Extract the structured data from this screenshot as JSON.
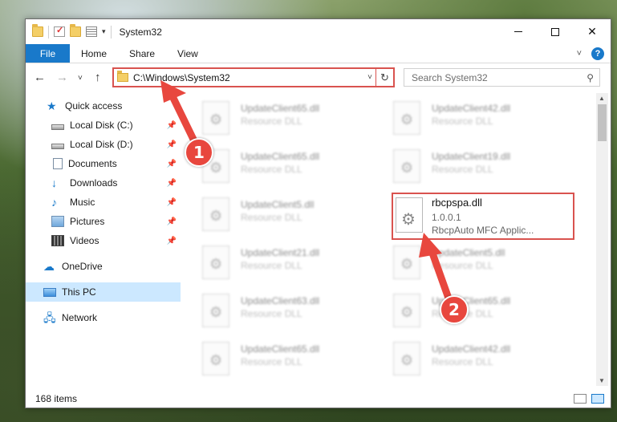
{
  "window": {
    "title": "System32",
    "caption": {
      "minimize": "",
      "maximize": "",
      "close": "✕"
    }
  },
  "ribbon": {
    "tabs": [
      "File",
      "Home",
      "Share",
      "View"
    ],
    "collapse_icon": "chevron-up-icon",
    "help": "?"
  },
  "address_bar": {
    "path": "C:\\Windows\\System32",
    "refresh_icon": "↻"
  },
  "search": {
    "placeholder": "Search System32"
  },
  "sidebar": {
    "items": [
      {
        "label": "Quick access",
        "icon": "star-icon",
        "pinned": false
      },
      {
        "label": "Local Disk (C:)",
        "icon": "disk-icon",
        "pinned": true
      },
      {
        "label": "Local Disk (D:)",
        "icon": "disk-icon",
        "pinned": true
      },
      {
        "label": "Documents",
        "icon": "document-icon",
        "pinned": true
      },
      {
        "label": "Downloads",
        "icon": "download-icon",
        "pinned": true
      },
      {
        "label": "Music",
        "icon": "music-icon",
        "pinned": true
      },
      {
        "label": "Pictures",
        "icon": "pictures-icon",
        "pinned": true
      },
      {
        "label": "Videos",
        "icon": "videos-icon",
        "pinned": true
      },
      {
        "label": "OneDrive",
        "icon": "cloud-icon",
        "pinned": false
      },
      {
        "label": "This PC",
        "icon": "computer-icon",
        "pinned": false,
        "selected": true
      },
      {
        "label": "Network",
        "icon": "network-icon",
        "pinned": false
      }
    ]
  },
  "files": [
    {
      "name": "UpdateClient65.dll",
      "type": "Resource DLL"
    },
    {
      "name": "UpdateClient42.dll",
      "type": "Resource DLL"
    },
    {
      "name": "UpdateClient65.dll",
      "type": "Resource DLL"
    },
    {
      "name": "UpdateClient19.dll",
      "type": "Resource DLL"
    },
    {
      "name": "UpdateClient5.dll",
      "type": "Resource DLL"
    },
    {
      "name": "UpdateClient21.dll",
      "type": "Resource DLL"
    },
    {
      "name": "UpdateClient5.dll",
      "type": "Resource DLL"
    },
    {
      "name": "UpdateClient63.dll",
      "type": "Resource DLL"
    },
    {
      "name": "UpdateClient65.dll",
      "type": "Resource DLL"
    },
    {
      "name": "UpdateClient65.dll",
      "type": "Resource DLL"
    },
    {
      "name": "UpdateClient42.dll",
      "type": "Resource DLL"
    }
  ],
  "highlighted_file": {
    "name": "rbcpspa.dll",
    "version": "1.0.0.1",
    "description": "RbcpAuto MFC Applic..."
  },
  "status": {
    "item_count": "168 items"
  },
  "annotations": {
    "marker_1": "1",
    "marker_2": "2",
    "color": "#e8473e"
  }
}
